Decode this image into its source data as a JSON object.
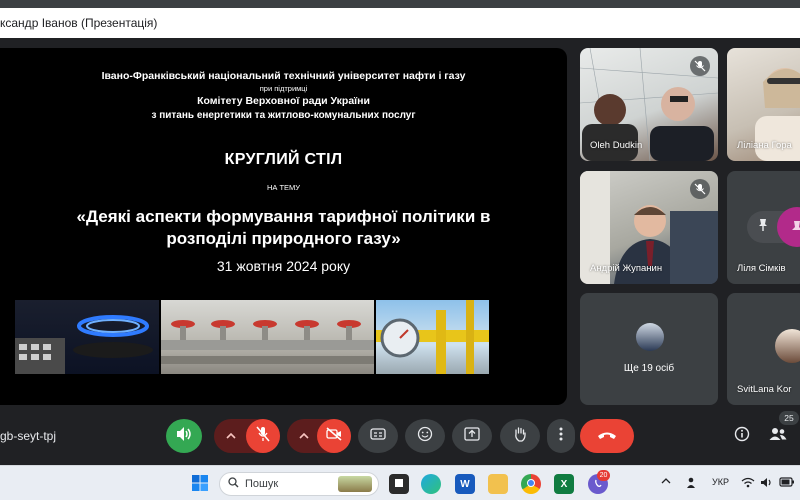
{
  "presenter_bar": {
    "title": "ксандр Іванов (Презентація)"
  },
  "slide": {
    "university": "Івано-Франківський національний технічний університет нафти і газу",
    "support": "при підтримці",
    "committee": "Комітету Верховної ради України",
    "committee_topic": "з питань енергетики та житлово-комунальних послуг",
    "event_type": "КРУГЛИЙ СТІЛ",
    "on_theme": "НА ТЕМУ",
    "topic_line1": "«Деякі аспекти формування тарифної політики в",
    "topic_line2": "розподілі природного газу»",
    "date": "31 жовтня 2024 року"
  },
  "participants": [
    {
      "name": "Oleh Dudkin",
      "muted": true
    },
    {
      "name": "Ліліана Гора",
      "muted": false
    },
    {
      "name": "Андрій Жупанин",
      "muted": true
    },
    {
      "name": "Ліля Сімків",
      "muted": false
    },
    {
      "name": "Ще 19 осіб",
      "muted": false
    },
    {
      "name": "SvitLana Kor",
      "muted": false
    }
  ],
  "controls": {
    "meeting_code": "gb-seyt-tpj",
    "people_count": "25"
  },
  "taskbar": {
    "search_label": "Пошук",
    "language": "УКР",
    "badge_count": "20",
    "word_letter": "W",
    "excel_letter": "X"
  },
  "colors": {
    "hangup_red": "#ea4335",
    "audio_green": "#34a853",
    "meet_bg": "#202124",
    "tile_gray": "#3c4043"
  },
  "icons": [
    "volume-icon",
    "mic-off-icon",
    "camera-off-icon",
    "captions-icon",
    "emoji-icon",
    "present-icon",
    "raise-hand-icon",
    "more-vert-icon",
    "hangup-icon",
    "info-icon",
    "people-icon",
    "pin-icon"
  ]
}
